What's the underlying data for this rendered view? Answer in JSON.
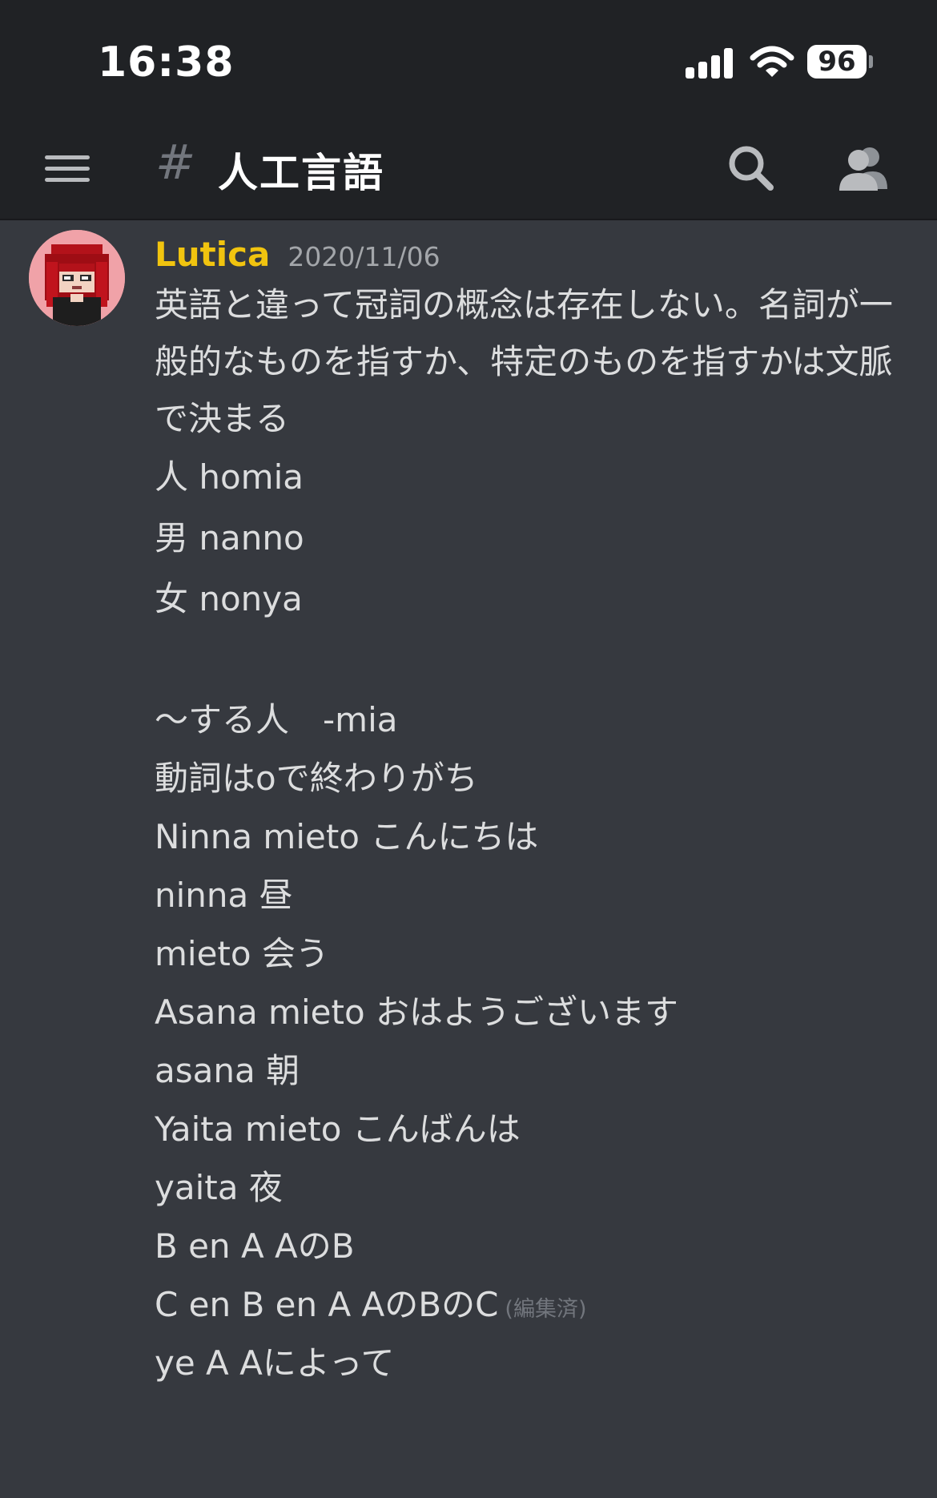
{
  "status_bar": {
    "time": "16:38",
    "battery": "96"
  },
  "header": {
    "channel_hash": "#",
    "channel_name": "人工言語"
  },
  "message": {
    "author": "Lutica",
    "timestamp": "2020/11/06",
    "paragraph": "英語と違って冠詞の概念は存在しない。名詞が一般的なものを指すか、特定のものを指すかは文脈で決まる",
    "lines": {
      "l1": "人 homia",
      "l2": "男 nanno",
      "l3": "女 nonya",
      "l4": "〜する人　-mia",
      "l5": "動詞はoで終わりがち",
      "l6": "Ninna mieto こんにちは",
      "l7": "ninna 昼",
      "l8": "mieto 会う",
      "l9": "Asana mieto おはようございます",
      "l10": "asana 朝",
      "l11": "Yaita mieto こんばんは",
      "l12": "yaita 夜",
      "l13": "B en A AのB",
      "l14": "C en B en A AのBのC",
      "l15": "ye A Aによって"
    },
    "edited_label": "(編集済)"
  },
  "colors": {
    "background": "#36393f",
    "header_background": "#202225",
    "username": "#f1c40f",
    "text": "#dcddde",
    "muted": "#72767d"
  },
  "icons": [
    "hamburger-menu-icon",
    "search-icon",
    "members-icon",
    "signal-icon",
    "wifi-icon",
    "battery-icon"
  ]
}
